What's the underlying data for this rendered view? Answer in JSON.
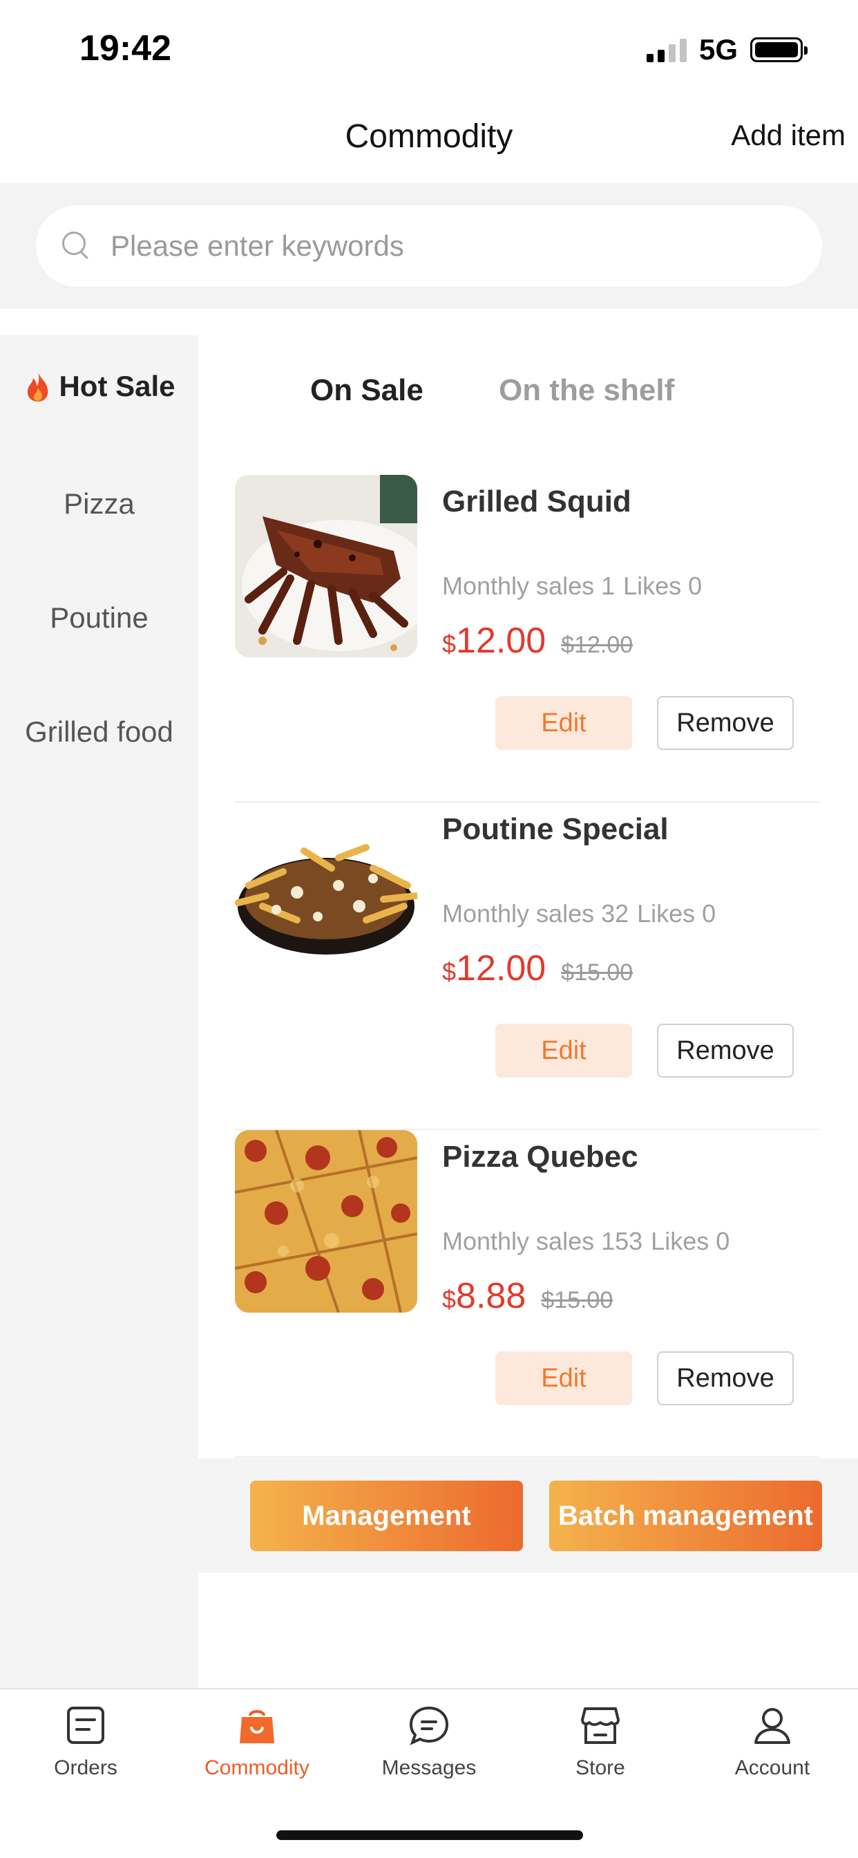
{
  "status_bar": {
    "time": "19:42",
    "network": "5G"
  },
  "header": {
    "title": "Commodity",
    "action_label": "Add item"
  },
  "search": {
    "placeholder": "Please enter keywords"
  },
  "sidebar": {
    "items": [
      {
        "label": "Hot Sale",
        "icon": "flame-icon",
        "active": true
      },
      {
        "label": "Pizza"
      },
      {
        "label": "Poutine"
      },
      {
        "label": "Grilled food"
      }
    ]
  },
  "tabs": [
    {
      "label": "On Sale",
      "active": true
    },
    {
      "label": "On the shelf"
    }
  ],
  "products": [
    {
      "name": "Grilled Squid",
      "monthly_sales": "Monthly sales 1",
      "likes": "Likes 0",
      "currency": "$",
      "price": "12.00",
      "original_price": "$12.00",
      "edit_label": "Edit",
      "remove_label": "Remove"
    },
    {
      "name": "Poutine Special",
      "monthly_sales": "Monthly sales 32",
      "likes": "Likes 0",
      "currency": "$",
      "price": "12.00",
      "original_price": "$15.00",
      "edit_label": "Edit",
      "remove_label": "Remove"
    },
    {
      "name": "Pizza Quebec",
      "monthly_sales": "Monthly sales 153",
      "likes": "Likes 0",
      "currency": "$",
      "price": "8.88",
      "original_price": "$15.00",
      "edit_label": "Edit",
      "remove_label": "Remove"
    }
  ],
  "management": {
    "management_label": "Management",
    "batch_label": "Batch management"
  },
  "bottom_nav": [
    {
      "label": "Orders",
      "icon": "orders-icon"
    },
    {
      "label": "Commodity",
      "icon": "shopping-bag-icon",
      "active": true
    },
    {
      "label": "Messages",
      "icon": "chat-icon"
    },
    {
      "label": "Store",
      "icon": "store-icon"
    },
    {
      "label": "Account",
      "icon": "person-icon"
    }
  ],
  "colors": {
    "accent": "#ee5a24",
    "price": "#e13a2c",
    "gradient_start": "#f4b34c",
    "gradient_end": "#ec6a2e"
  }
}
